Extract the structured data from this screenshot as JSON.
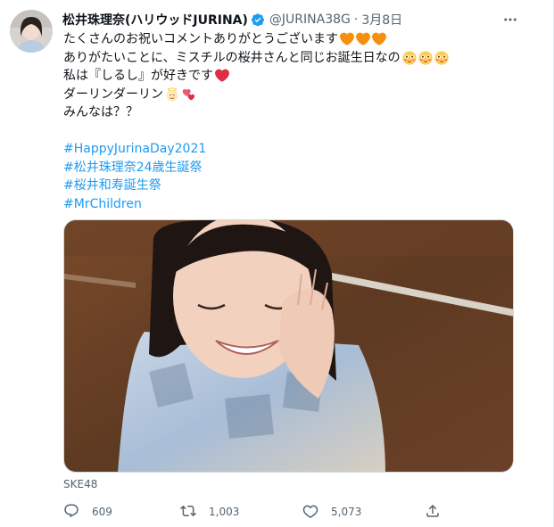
{
  "tweet": {
    "display_name": "松井珠理奈(ハリウッドJURINA)",
    "handle": "@JURINA38G",
    "separator": "·",
    "timestamp": "3月8日",
    "lines": [
      "たくさんのお祝いコメントありがとうございます",
      "ありがたいことに、ミスチルの桜井さんと同じお誕生日なの",
      "私は『しるし』が好きです",
      "ダーリンダーリン",
      "みんなは？？"
    ],
    "hashtags": [
      "#HappyJurinaDay2021",
      "#松井珠理奈24歳生誕祭",
      "#桜井和寿誕生祭",
      "#MrChildren"
    ],
    "source": "SKE48",
    "stats": {
      "replies": "609",
      "retweets": "1,003",
      "likes": "5,073"
    }
  },
  "icons": {
    "verified": "verified-badge-icon",
    "more": "more-options-icon",
    "reply": "reply-icon",
    "retweet": "retweet-icon",
    "like": "heart-icon",
    "share": "share-icon"
  },
  "colors": {
    "accent": "#1d9bf0",
    "muted_text": "#536471",
    "text": "#0f1419",
    "orange_heart": "#f4900c",
    "red_heart": "#dd2e44"
  }
}
